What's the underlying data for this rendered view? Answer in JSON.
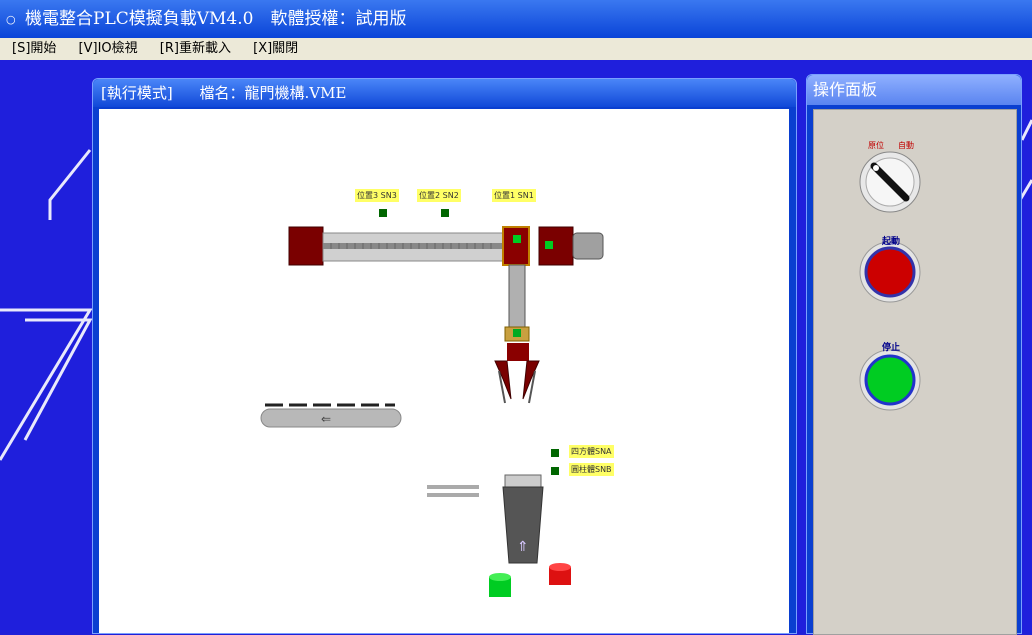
{
  "app": {
    "title": "機電整合PLC模擬負載VM4.0　軟體授權：試用版"
  },
  "menu": {
    "items": [
      "[S]開始",
      "[V]IO檢視",
      "[R]重新載入",
      "[X]關閉"
    ]
  },
  "sim_window": {
    "title_mode": "[執行模式]",
    "title_file": "檔名：龍門機構.VME"
  },
  "sensors": {
    "pos3": "位置3 SN3",
    "pos2": "位置2 SN2",
    "pos1": "位置1 SN1",
    "square": "四方體SNA",
    "cylinder": "圓柱體SNB"
  },
  "panel": {
    "title": "操作面板",
    "selector_left": "原位",
    "selector_right": "自動",
    "start_label": "起動",
    "stop_label": "停止"
  },
  "colors": {
    "start_button": "#cc0000",
    "stop_button": "#00cc22",
    "sensor_indicator": "#006600",
    "label_bg": "#ffff66"
  }
}
